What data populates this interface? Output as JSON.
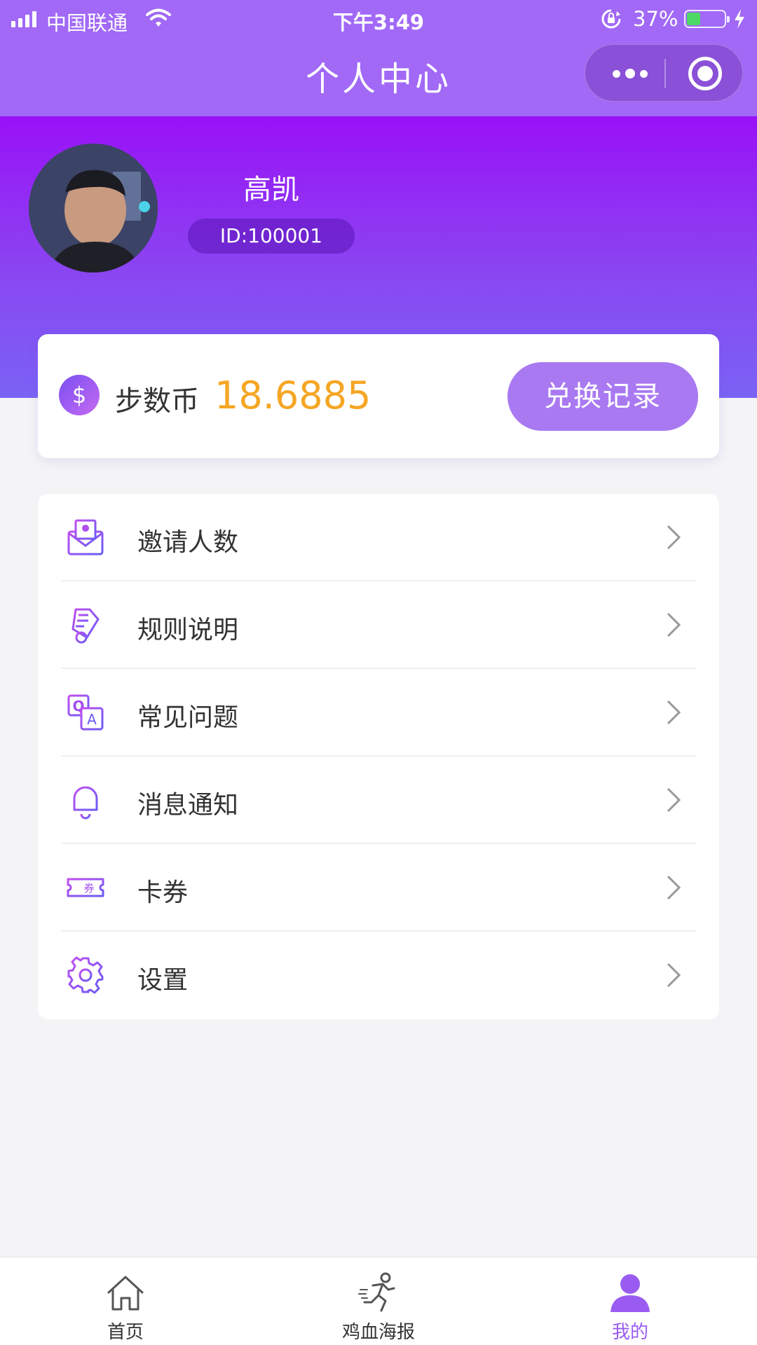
{
  "status_bar": {
    "carrier": "中国联通",
    "time": "下午3:49",
    "battery_percent": "37%",
    "battery_level": 0.37
  },
  "nav": {
    "title": "个人中心"
  },
  "profile": {
    "name": "高凯",
    "id": "ID:100001"
  },
  "coins": {
    "label": "步数币",
    "value": "18.6885",
    "icon_symbol": "$",
    "exchange_label": "兑换记录"
  },
  "menu": [
    {
      "label": "邀请人数",
      "icon": "invite-envelope-icon"
    },
    {
      "label": "规则说明",
      "icon": "rules-scroll-icon"
    },
    {
      "label": "常见问题",
      "icon": "faq-qa-icon"
    },
    {
      "label": "消息通知",
      "icon": "bell-icon"
    },
    {
      "label": "卡券",
      "icon": "coupon-icon"
    },
    {
      "label": "设置",
      "icon": "gear-icon"
    }
  ],
  "coupon_icon_text": "券",
  "tabs": [
    {
      "label": "首页",
      "icon": "home-icon"
    },
    {
      "label": "鸡血海报",
      "icon": "runner-icon"
    },
    {
      "label": "我的",
      "icon": "user-icon",
      "active": true
    }
  ],
  "colors": {
    "nav_bg": "#a169f6",
    "hero_gradient_top": "#9a10f7",
    "hero_gradient_bottom": "#7a63f5",
    "coin_value": "#f5a623",
    "button_purple": "#a979f2",
    "active_tab": "#9a5cf0"
  }
}
